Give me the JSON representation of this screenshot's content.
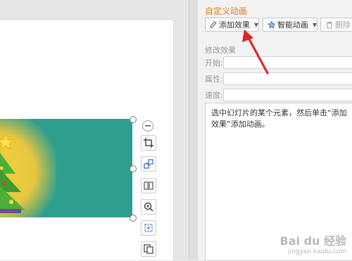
{
  "pane": {
    "title": "自定义动画",
    "add_effect_label": "添加效果",
    "smart_anim_label": "智能动画",
    "delete_label": "删除",
    "modify_section": "修改效果",
    "start_label": "开始:",
    "property_label": "属性:",
    "speed_label": "速度:",
    "hint_text": "选中幻灯片的某个元素，然后单击“添加效果”添加动画。"
  },
  "icons": {
    "pencil": "pencil-icon",
    "smart": "smart-animation-icon",
    "delete": "delete-icon",
    "crop": "crop-icon",
    "replace": "replace-image-icon",
    "split": "split-image-icon",
    "zoom": "zoom-icon",
    "extract": "extract-icon",
    "convert": "convert-icon",
    "minus": "minus-icon"
  },
  "colors": {
    "accent": "#e07b22",
    "slide_image_bg": "#2e9e8e",
    "annotation_arrow": "#e0202a"
  },
  "watermark": {
    "brand": "Bai du 经验",
    "url": "jingyan.baidu.com"
  }
}
